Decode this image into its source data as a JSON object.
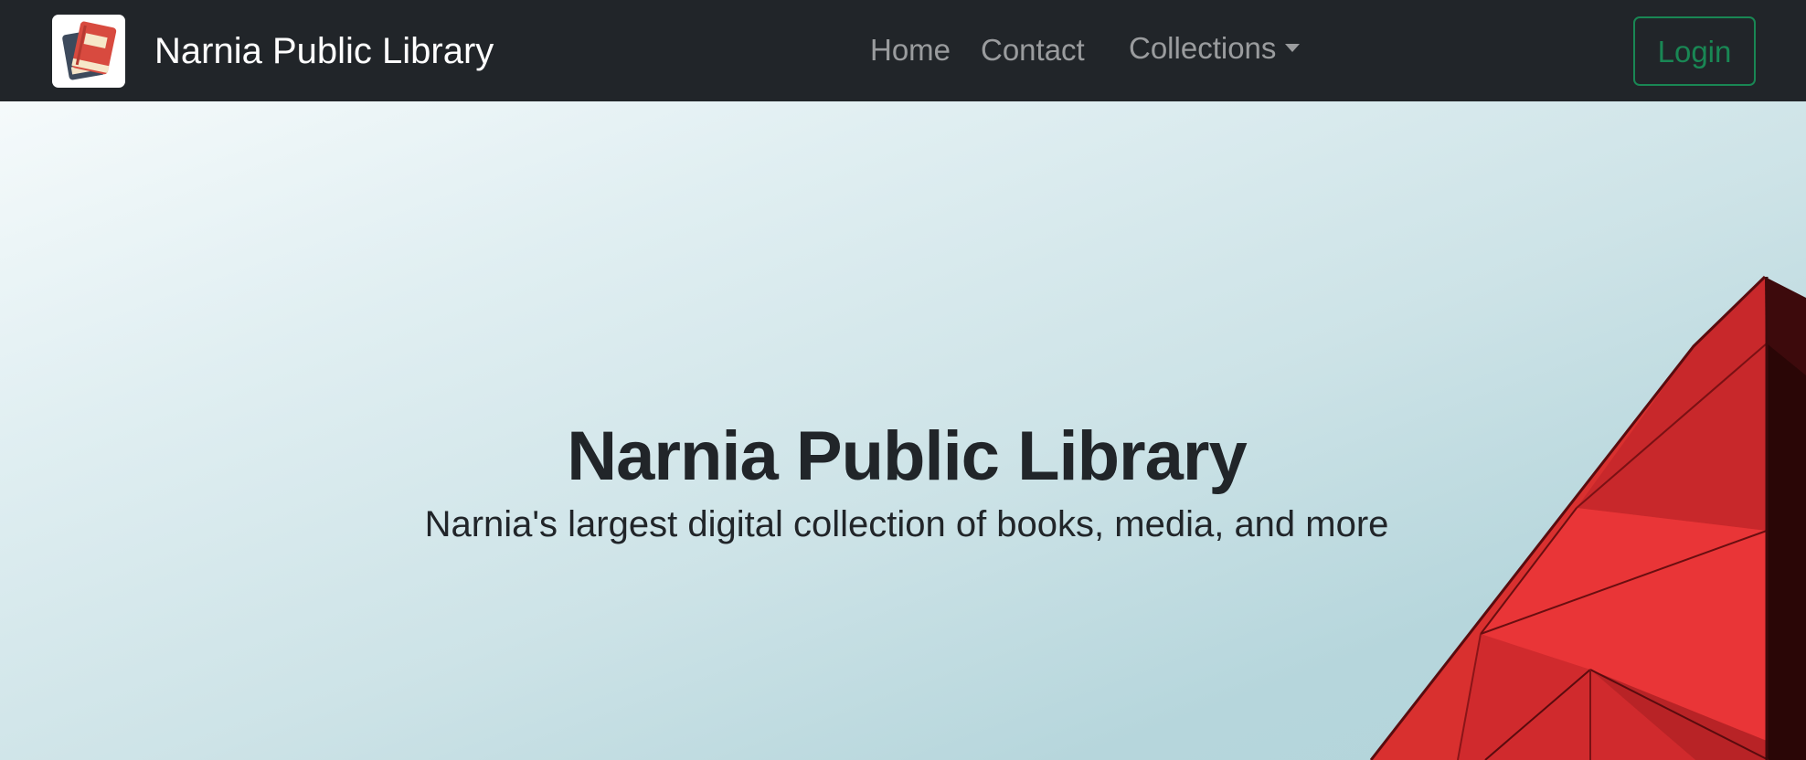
{
  "navbar": {
    "brand_title": "Narnia Public Library",
    "logo_icon": "books-logo-icon",
    "links": {
      "home": "Home",
      "contact": "Contact",
      "collections": "Collections"
    },
    "login_label": "Login"
  },
  "hero": {
    "title": "Narnia Public Library",
    "subtitle": "Narnia's largest digital collection of books, media, and more",
    "background_image": "red-building-facade"
  },
  "colors": {
    "navbar_bg": "#212529",
    "login_accent": "#198754",
    "building_red": "#e02f32",
    "sky": "#cde3e7"
  }
}
